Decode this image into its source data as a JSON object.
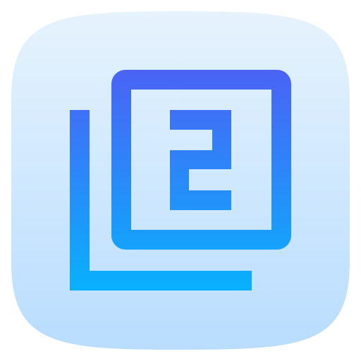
{
  "app_icon": {
    "icon_name": "filter-2-icon",
    "background_gradient": {
      "top": "#E6F3FD",
      "bottom": "#B9DDFE"
    },
    "glyph_gradient": {
      "top": "#4A63F5",
      "bottom": "#08B1FD"
    }
  }
}
